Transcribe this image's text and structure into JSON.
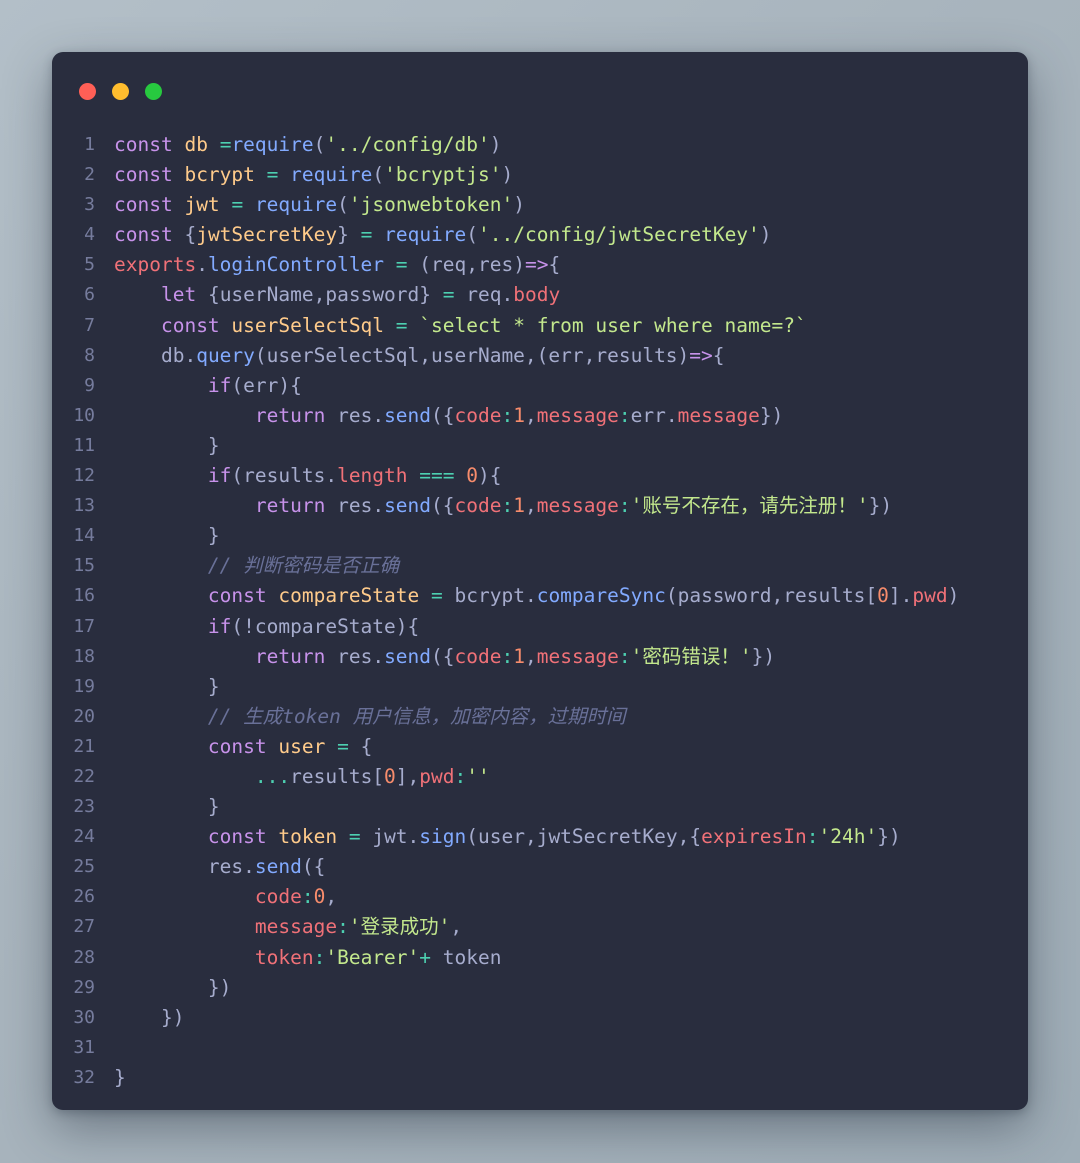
{
  "window": {
    "name": "code-snippet-window",
    "background_color": "#abb8c3",
    "surface_color": "#292d3e",
    "traffic_lights": [
      {
        "name": "close-button",
        "label": "Close",
        "color": "#ff5f56"
      },
      {
        "name": "minimize-button",
        "label": "Minimize",
        "color": "#ffbd2e"
      },
      {
        "name": "maximize-button",
        "label": "Maximize",
        "color": "#27c93f"
      }
    ]
  },
  "theme": {
    "line_number_color": "#767c9d",
    "plain_color": "#a6accd",
    "keyword_color": "#c792ea",
    "variable_color": "#ffcb8b",
    "operator_color": "#4dd0b1",
    "function_color": "#82aaff",
    "string_color": "#c3e88d",
    "number_color": "#f78c6c",
    "property_color": "#f07178",
    "comment_color": "#697098"
  },
  "editor": {
    "language": "javascript",
    "total_lines": 32,
    "line_numbers": [
      "1",
      "2",
      "3",
      "4",
      "5",
      "6",
      "7",
      "8",
      "9",
      "10",
      "11",
      "12",
      "13",
      "14",
      "15",
      "16",
      "17",
      "18",
      "19",
      "20",
      "21",
      "22",
      "23",
      "24",
      "25",
      "26",
      "27",
      "28",
      "29",
      "30",
      "31",
      "32"
    ],
    "lines": [
      "const db =require('../config/db')",
      "const bcrypt = require('bcryptjs')",
      "const jwt = require('jsonwebtoken')",
      "const {jwtSecretKey} = require('../config/jwtSecretKey')",
      "exports.loginController = (req,res)=>{",
      "    let {userName,password} = req.body",
      "    const userSelectSql = `select * from user where name=?`",
      "    db.query(userSelectSql,userName,(err,results)=>{",
      "        if(err){",
      "            return res.send({code:1,message:err.message})",
      "        }",
      "        if(results.length === 0){",
      "            return res.send({code:1,message:'账号不存在，请先注册！'})",
      "        }",
      "        // 判断密码是否正确",
      "        const compareState = bcrypt.compareSync(password,results[0].pwd)",
      "        if(!compareState){",
      "            return res.send({code:1,message:'密码错误！'})",
      "        }",
      "        // 生成token 用户信息，加密内容，过期时间",
      "        const user = {",
      "            ...results[0],pwd:''",
      "        }",
      "        const token = jwt.sign(user,jwtSecretKey,{expiresIn:'24h'})",
      "        res.send({",
      "            code:0,",
      "            message:'登录成功',",
      "            token:'Bearer'+ token",
      "        })",
      "    })",
      "",
      "}"
    ]
  }
}
